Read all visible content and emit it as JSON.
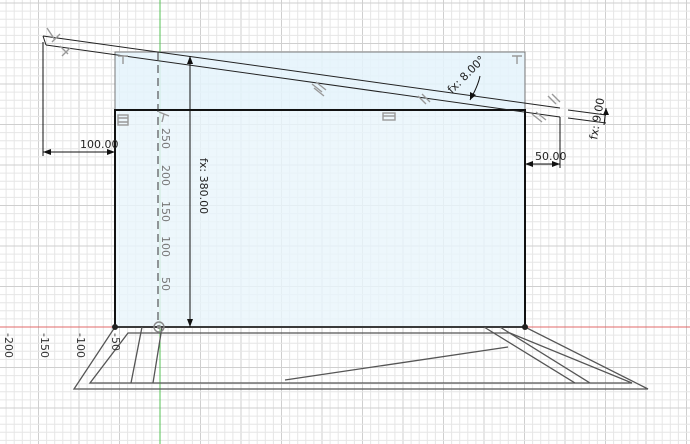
{
  "dimensions": {
    "left_offset": "100.00",
    "right_offset": "50.00",
    "height": "fx: 380.00",
    "angle": "fx: 8.00°",
    "thickness": "fx: 9.00"
  },
  "ruler_vertical": [
    "250",
    "200",
    "150",
    "100",
    "50"
  ],
  "ruler_horizontal": [
    "-200",
    "-150",
    "-100",
    "-50"
  ],
  "colors": {
    "x_axis": "#e06a6a",
    "y_axis": "#55c255",
    "profile_fill": "#e4f3fb",
    "grid": "#e6e6e6"
  },
  "constraint_icons": [
    "perpendicular-icon",
    "parallel-icon",
    "horizontal-icon",
    "coincident-icon"
  ]
}
